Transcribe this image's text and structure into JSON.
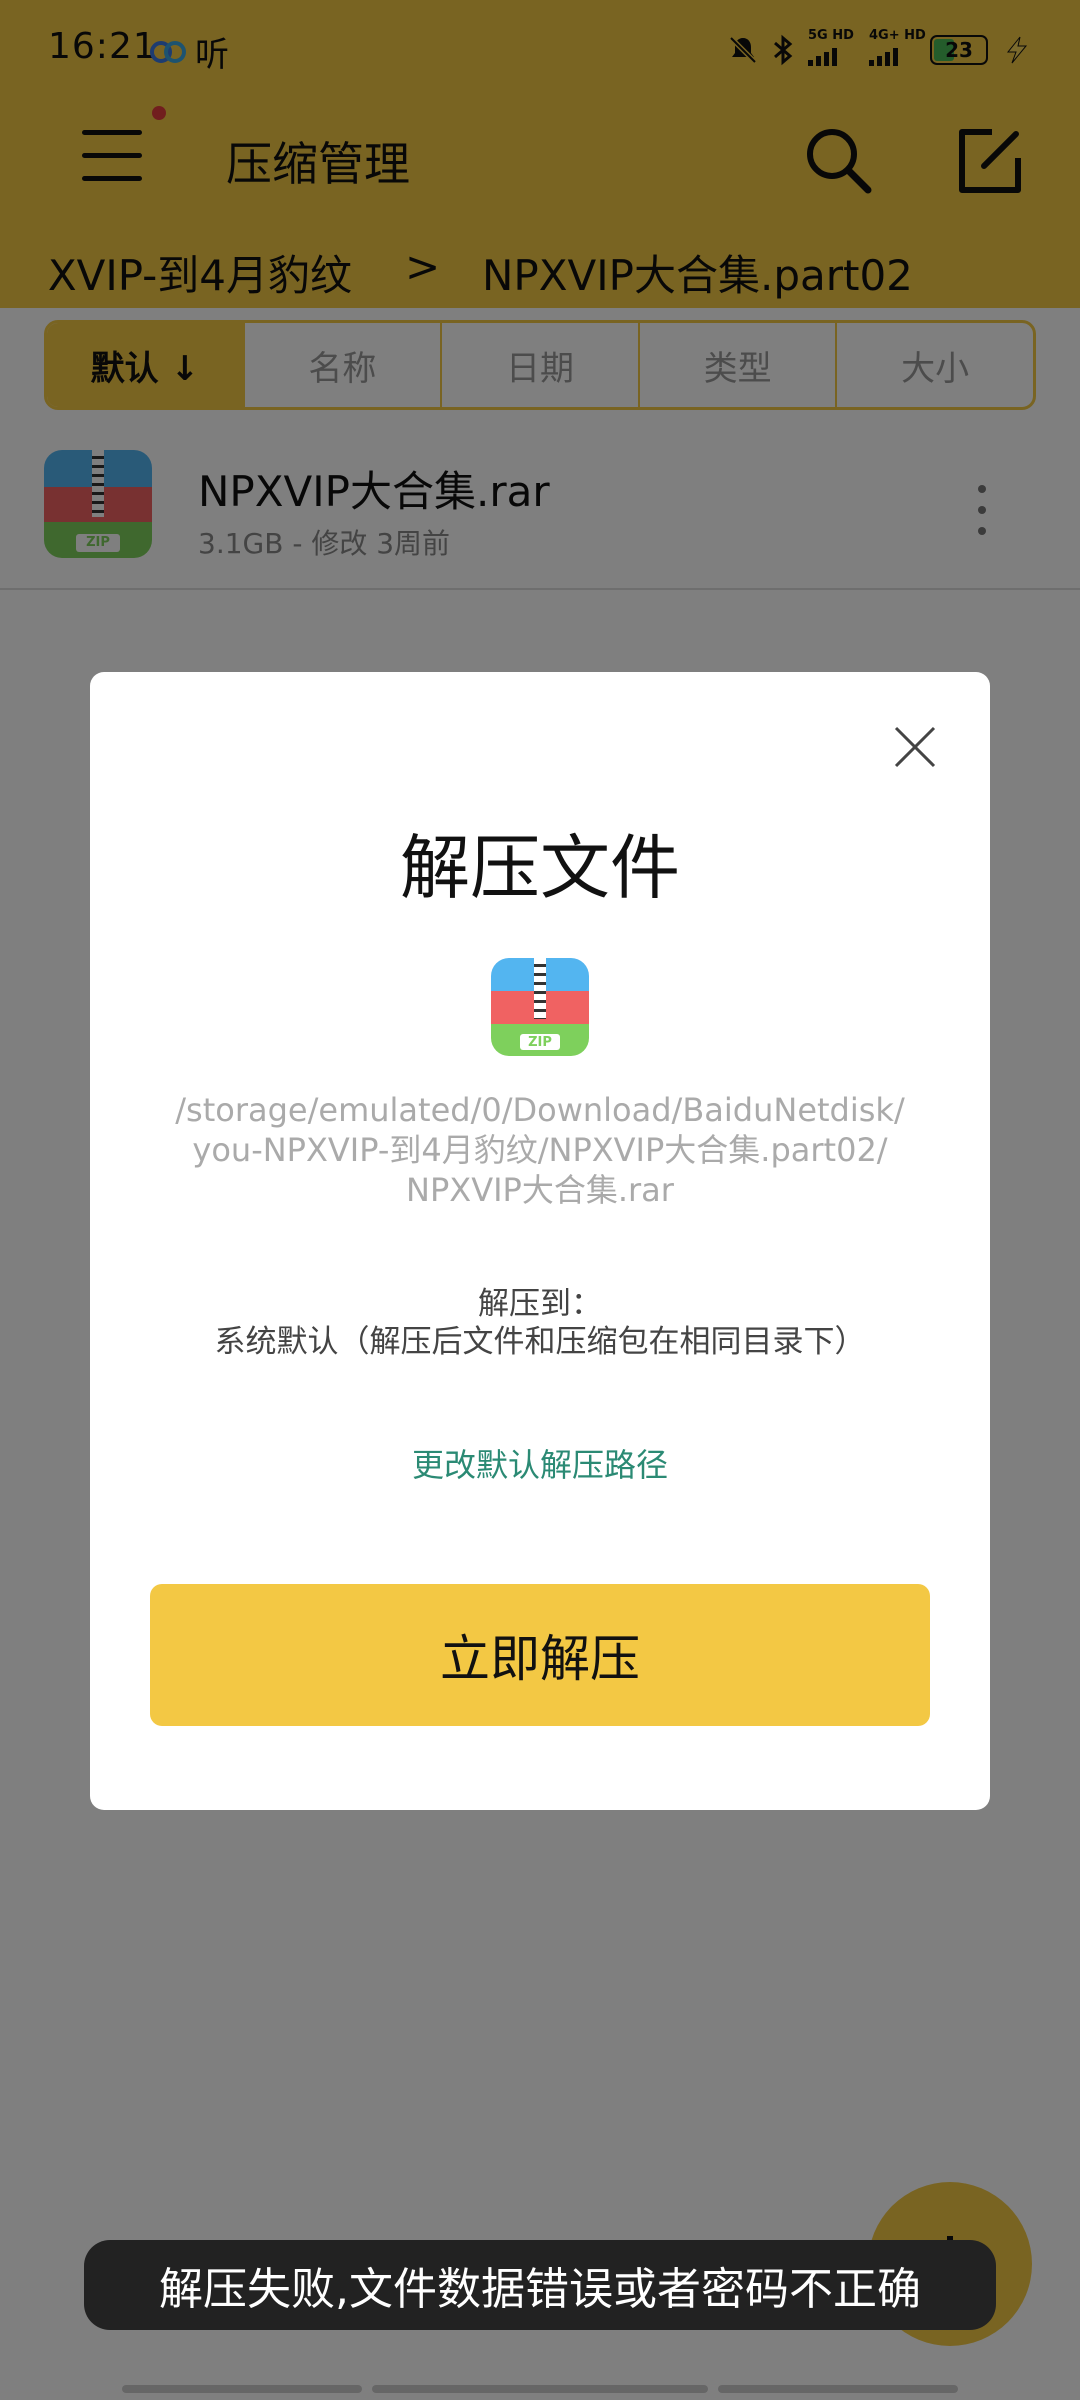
{
  "status_bar": {
    "time": "16:21",
    "app_label": "听",
    "signal1_label": "5G HD",
    "signal2_label": "4G+ HD",
    "battery": "23",
    "icons": [
      "cloud-icon",
      "mute-icon",
      "bluetooth-icon",
      "signal-icon",
      "battery-icon",
      "charging-icon"
    ]
  },
  "app_bar": {
    "title": "压缩管理",
    "menu_icon": "menu-icon",
    "search_icon": "search-icon",
    "edit_icon": "edit-icon"
  },
  "breadcrumb": {
    "items": [
      "XVIP-到4月豹纹",
      "NPXVIP大合集.part02"
    ],
    "separator": ">"
  },
  "sort_tabs": [
    {
      "label": "默认 ↓",
      "active": true
    },
    {
      "label": "名称",
      "active": false
    },
    {
      "label": "日期",
      "active": false
    },
    {
      "label": "类型",
      "active": false
    },
    {
      "label": "大小",
      "active": false
    }
  ],
  "files": [
    {
      "name": "NPXVIP大合集.rar",
      "meta": "3.1GB - 修改 3周前",
      "icon_tag": "ZIP"
    }
  ],
  "dialog": {
    "title": "解压文件",
    "icon_tag": "ZIP",
    "path_lines": [
      "/storage/emulated/0/Download/BaiduNetdisk/",
      "you-NPXVIP-到4月豹纹/NPXVIP大合集.part02/",
      "NPXVIP大合集.rar"
    ],
    "target_label": "解压到：",
    "target_value": "系统默认（解压后文件和压缩包在相同目录下）",
    "change_path_link": "更改默认解压路径",
    "confirm_button": "立即解压"
  },
  "toast": "解压失败,文件数据错误或者密码不正确",
  "colors": {
    "accent": "#f3c844",
    "link": "#2b8a74",
    "badge": "#e23d3d"
  }
}
